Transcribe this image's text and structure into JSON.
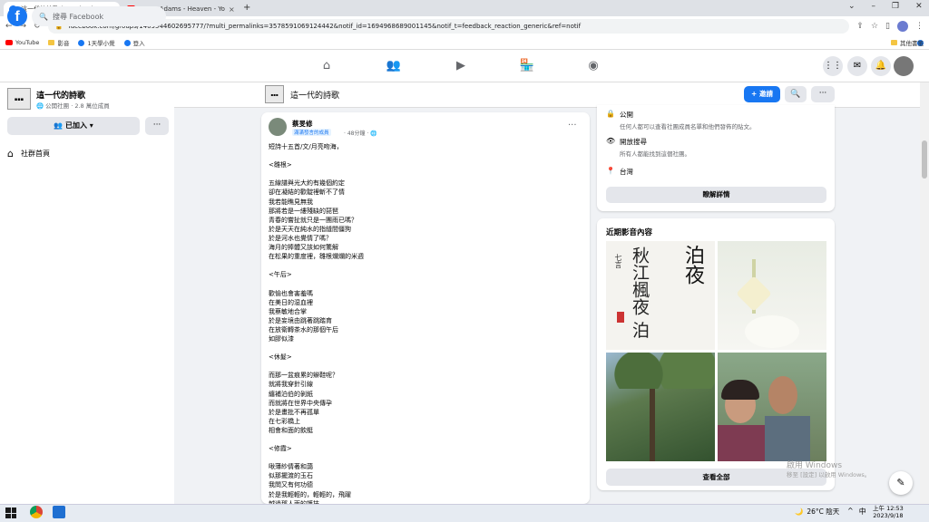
{
  "browser": {
    "tabs": [
      {
        "title": "這一代的詩歌 | Facebook",
        "color": "#1877f2"
      },
      {
        "title": "Bryan Adams - Heaven - Yo",
        "color": "#ff0000"
      }
    ],
    "new_tab": "+",
    "url": "facebook.com/groups/1409544602695777/?multi_permalinks=3578591069124442&notif_id=1694968689001145&notif_t=feedback_reaction_generic&ref=notif",
    "bookmarks": [
      {
        "label": "YouTube",
        "icon": "youtube-icon"
      },
      {
        "label": "影音",
        "icon": "folder-icon"
      },
      {
        "label": "1天學小覺",
        "icon": "facebook-icon"
      },
      {
        "label": "登入",
        "icon": "facebook-icon"
      }
    ],
    "other_bookmarks": "其他書籤"
  },
  "fb": {
    "logo": "f",
    "search_placeholder": "搜尋 Facebook",
    "nav": [
      "home-icon",
      "friends-icon",
      "watch-icon",
      "marketplace-icon",
      "groups-icon"
    ]
  },
  "group": {
    "name": "這一代的詩歌",
    "meta": "🌐 公開社團 · 2.8 萬位成員",
    "joined_label": "已加入",
    "more": "···",
    "home_label": "社群首頁",
    "invite_label": "+ 邀請"
  },
  "post": {
    "author": "蔡旻修",
    "badge": "滿滿發言的成員",
    "time": "· 48分鐘 · 🌐",
    "text": "短詩十五首/文/月亮吻海，\n\n<雛根>\n\n五線譜與光大約有幾個約定\n卻在凝結的歡靛裡斬不了情\n我若能瞧見無我\n那將若是一縷殘缺的琵琶\n青春的嘗扯就只是一團雨已嗎？\n於是天天在純水的指縫間僵狗\n於是河水也覺情了嗎？\n海月的捧體又該如何驚解\n在松果的重度裡，雛根爛爛的米週\n\n<午后>\n\n歡愉也會害羞嗎\n在美日的湿血裡\n我蔡敏地合掌\n於是妄境由跳著跳踏育\n在放衛轉茶水的那個午后\n如膠似漆\n\n<休髮>\n\n而那一盆痕累的辮鞋呢？\n就將我穿針引線\n纏補泊伯的剝紙\n而就將在世界中央傳孕\n於是畫批不再孤單\n在七彩橋上\n相會和面的飲艇\n\n<修霞>\n\n啾薄紗倩著和藹\n似那擺渡的玉石\n我問又有何功德\n於是我輕輕的，輕輕的，飛躍\n越過那人兩的護技\n在莫典的籽簾中\n誤下一堆，修霞語"
  },
  "about": {
    "items": [
      {
        "icon": "globe-icon",
        "glyph": "🔒",
        "title": "公開",
        "sub": "任何人都可以查看社團成員名單和他們發佈的貼文。"
      },
      {
        "icon": "eye-icon",
        "glyph": "👁",
        "title": "開放搜尋",
        "sub": "所有人都能找到這個社團。"
      },
      {
        "icon": "location-icon",
        "glyph": "📍",
        "title": "台灣",
        "sub": ""
      }
    ],
    "learn_more": "瞭解詳情"
  },
  "media": {
    "title": "近期影音內容",
    "see_all": "查看全部",
    "calligraphy_text": "秋江楓夜 泊"
  },
  "watermark": {
    "line1": "啟用 Windows",
    "line2": "移至 [設定] 以啟用 Windows。"
  },
  "taskbar": {
    "weather": "26°C 陰天",
    "ime": "中",
    "time": "上午 12:53",
    "date": "2023/9/18"
  }
}
